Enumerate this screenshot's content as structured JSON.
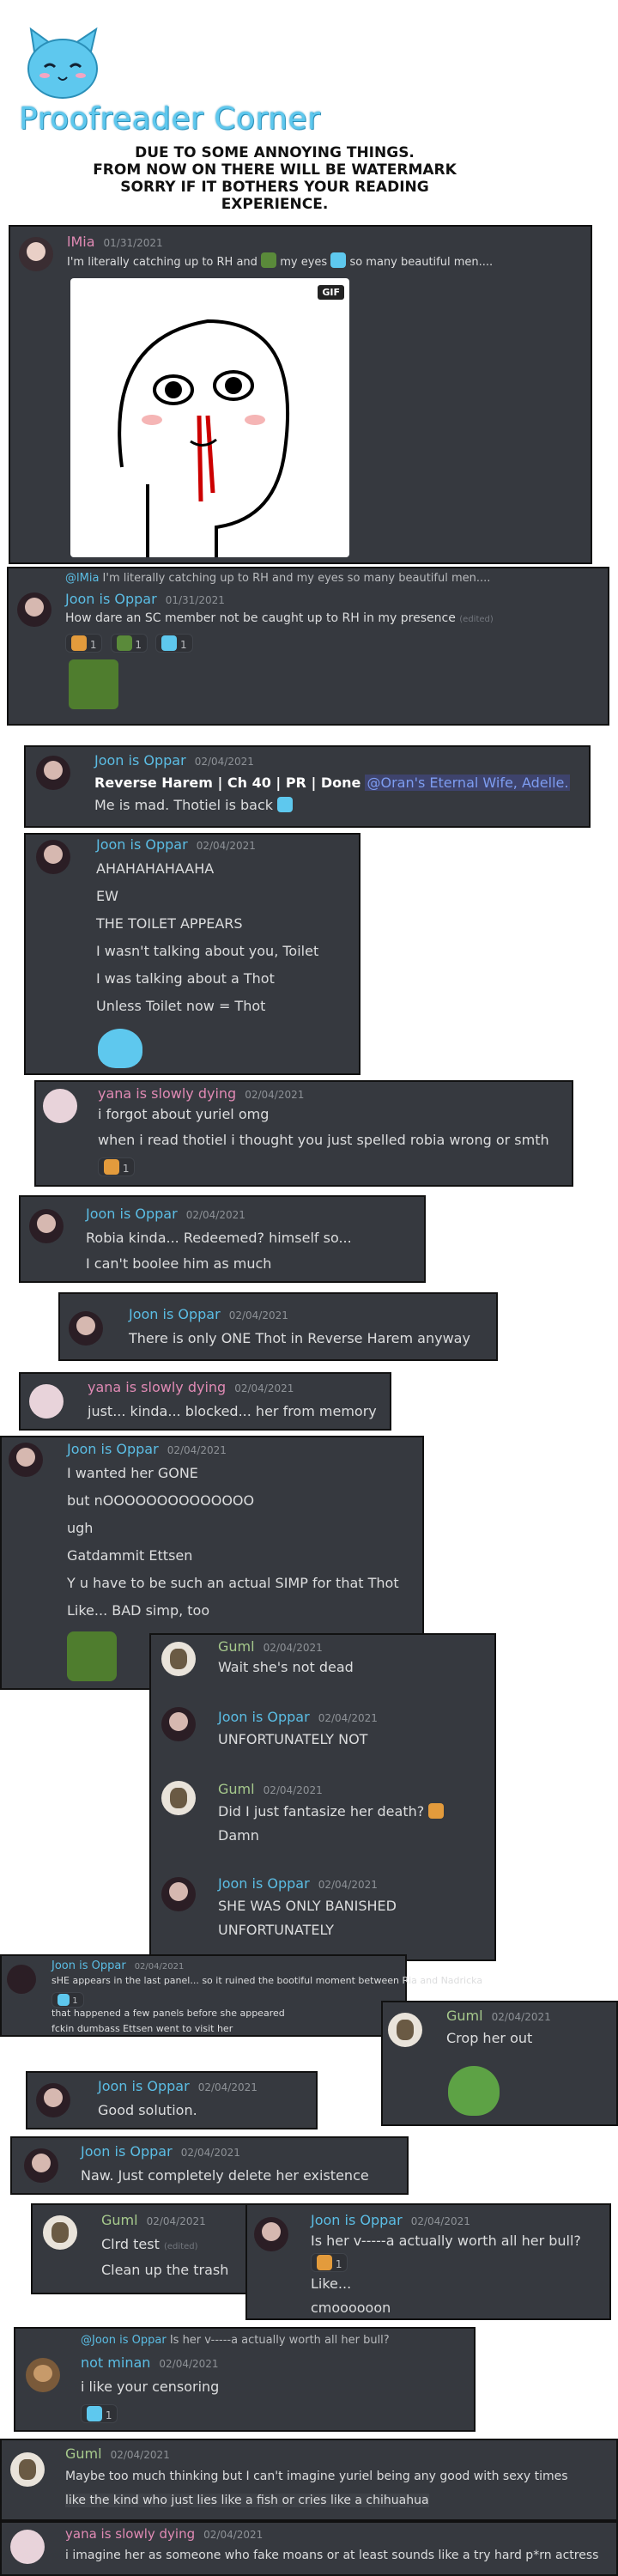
{
  "header": {
    "brand": "Proofreader Corner",
    "notice_lines": [
      "Due to some annoying things.",
      "From now on there will be watermark",
      "Sorry if it bothers your reading",
      "experience."
    ]
  },
  "colors": {
    "panel": "#36393f",
    "name_blue": "#5bbde4",
    "name_pink": "#e08ab4",
    "name_green": "#a6c98c"
  },
  "messages": [
    {
      "name": "lMia",
      "date": "01/31/2021",
      "lines": [
        "I'm literally catching up to RH and",
        "my eyes",
        "so many beautiful men...."
      ],
      "gif_badge": "GIF"
    },
    {
      "reply_to": "@lMia",
      "reply_text": "I'm literally catching up to RH and  my eyes  so many beautiful men....",
      "name": "Joon is Oppar",
      "date": "01/31/2021",
      "lines": [
        "How dare an SC member not be caught up to RH in my presence"
      ],
      "edited": "(edited)",
      "reactions": [
        "1",
        "1",
        "1"
      ]
    },
    {
      "name": "Joon is Oppar",
      "date": "02/04/2021",
      "lines": [
        "Reverse Harem | Ch 40 | PR | Done",
        "@Oran's Eternal Wife, Adelle.",
        "Me is mad. Thotiel is back"
      ]
    },
    {
      "name": "Joon is Oppar",
      "date": "02/04/2021",
      "lines": [
        "AHAHAHAHAAHA",
        "EW",
        "THE TOILET APPEARS",
        "I wasn't talking about you, Toilet",
        "I was talking about a Thot",
        "Unless Toilet now = Thot"
      ]
    },
    {
      "name": "yana is slowly dying",
      "date": "02/04/2021",
      "lines": [
        "i forgot about yuriel omg",
        "when i read thotiel i thought you just spelled robia wrong or smth"
      ],
      "reactions": [
        "1"
      ]
    },
    {
      "name": "Joon is Oppar",
      "date": "02/04/2021",
      "lines": [
        "Robia kinda... Redeemed? himself so...",
        "I can't boolee him as much"
      ]
    },
    {
      "name": "Joon is Oppar",
      "date": "02/04/2021",
      "lines": [
        "There is only ONE Thot in Reverse Harem anyway"
      ]
    },
    {
      "name": "yana is slowly dying",
      "date": "02/04/2021",
      "lines": [
        "just... kinda... blocked... her from memory"
      ]
    },
    {
      "name": "Joon is Oppar",
      "date": "02/04/2021",
      "lines": [
        "I wanted her GONE",
        "but nOOOOOOOOOOOOOO",
        "ugh",
        "Gatdammit Ettsen",
        "Y u have to be such an actual SIMP for that Thot",
        "Like... BAD simp, too"
      ]
    },
    {
      "name": "Guml",
      "date": "02/04/2021",
      "lines": [
        "Wait she's not dead"
      ]
    },
    {
      "name": "Joon is Oppar",
      "date": "02/04/2021",
      "lines": [
        "UNFORTUNATELY NOT"
      ]
    },
    {
      "name": "Guml",
      "date": "02/04/2021",
      "lines": [
        "Did I just fantasize her death?",
        "Damn"
      ]
    },
    {
      "name": "Joon is Oppar",
      "date": "02/04/2021",
      "lines": [
        "SHE WAS ONLY BANISHED",
        "UNFORTUNATELY"
      ]
    },
    {
      "name": "Joon is Oppar",
      "date": "02/04/2021",
      "lines": [
        "sHE appears in the last panel... so it ruined the bootiful moment between Ria and Nadricka",
        "that happened a few panels before she appeared",
        "fckin dumbass Ettsen went to visit her"
      ],
      "reactions": [
        "1"
      ]
    },
    {
      "name": "Guml",
      "date": "02/04/2021",
      "lines": [
        "Crop her out"
      ]
    },
    {
      "name": "Joon is Oppar",
      "date": "02/04/2021",
      "lines": [
        "Good solution."
      ]
    },
    {
      "name": "Joon is Oppar",
      "date": "02/04/2021",
      "lines": [
        "Naw. Just completely delete her existence"
      ]
    },
    {
      "name": "Guml",
      "date": "02/04/2021",
      "lines": [
        "Clrd test",
        "Clean up the trash"
      ],
      "edited": "(edited)"
    },
    {
      "name": "Joon is Oppar",
      "date": "02/04/2021",
      "lines": [
        "Is her v-----a actually worth all her bull?",
        "Like...",
        "cmoooooon"
      ],
      "reactions": [
        "1"
      ]
    },
    {
      "reply_to": "@Joon is Oppar",
      "reply_text": "Is her v-----a actually worth all her bull?",
      "name": "not minan",
      "date": "02/04/2021",
      "lines": [
        "i like your censoring"
      ],
      "reactions": [
        "1"
      ]
    },
    {
      "name": "Guml",
      "date": "02/04/2021",
      "lines": [
        "Maybe too much thinking but I can't imagine yuriel being any good with sexy times",
        "like the kind who just lies like a fish or cries like a chihuahua"
      ]
    },
    {
      "name": "yana is slowly dying",
      "date": "02/04/2021",
      "lines": [
        "i imagine her as someone who fake moans or at least sounds like a try hard p*rn actress"
      ]
    }
  ]
}
